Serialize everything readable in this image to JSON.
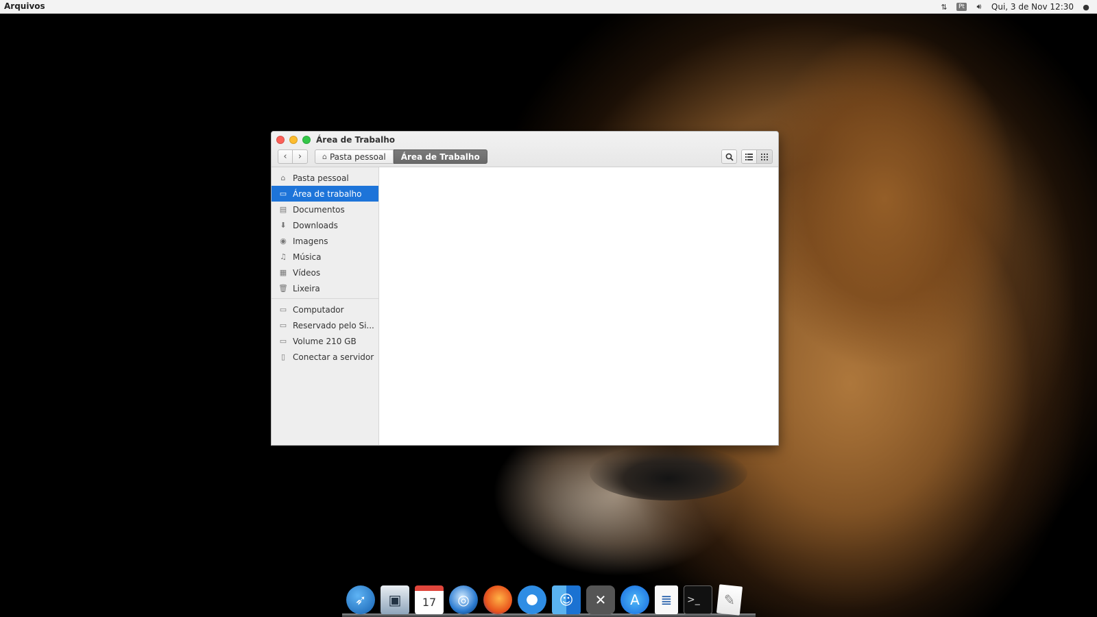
{
  "topbar": {
    "app_name": "Arquivos",
    "language": "Pt",
    "clock": "Qui,  3 de Nov 12:30",
    "icons": [
      "network-icon",
      "volume-icon",
      "apple-icon"
    ]
  },
  "window": {
    "title": "Área de Trabalho",
    "breadcrumb": {
      "home": "Pasta pessoal",
      "current": "Área de Trabalho"
    },
    "sidebar": {
      "places": [
        {
          "label": "Pasta pessoal",
          "icon": "home-icon"
        },
        {
          "label": "Área de trabalho",
          "icon": "desktop-icon",
          "selected": true
        },
        {
          "label": "Documentos",
          "icon": "documents-icon"
        },
        {
          "label": "Downloads",
          "icon": "downloads-icon"
        },
        {
          "label": "Imagens",
          "icon": "camera-icon"
        },
        {
          "label": "Música",
          "icon": "music-icon"
        },
        {
          "label": "Vídeos",
          "icon": "video-icon"
        },
        {
          "label": "Lixeira",
          "icon": "trash-icon"
        }
      ],
      "devices": [
        {
          "label": "Computador",
          "icon": "drive-icon"
        },
        {
          "label": "Reservado pelo Si...",
          "icon": "drive-icon"
        },
        {
          "label": "Volume 210 GB",
          "icon": "drive-icon"
        },
        {
          "label": "Conectar a servidor",
          "icon": "server-icon"
        }
      ]
    }
  },
  "dock": {
    "apps": [
      "eagle-app-icon",
      "preview-app-icon",
      "calendar-app-icon",
      "quicktime-app-icon",
      "firefox-app-icon",
      "chromium-app-icon",
      "finder-app-icon",
      "system-tools-app-icon",
      "app-store-icon",
      "document-viewer-app-icon",
      "terminal-app-icon",
      "notes-app-icon"
    ],
    "calendar_day": "17"
  }
}
